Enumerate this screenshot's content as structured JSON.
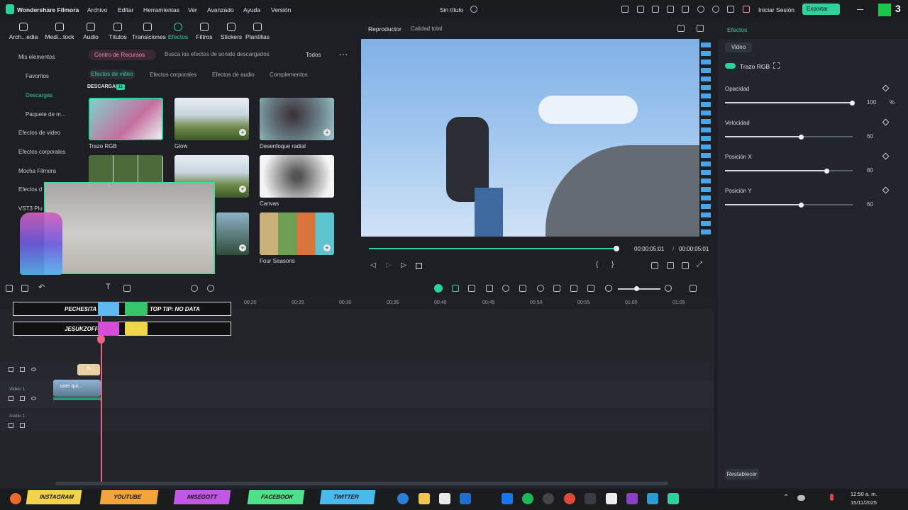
{
  "title_bar": {
    "app_name": "Wondershare Filmora",
    "menu": [
      "Archivo",
      "Editar",
      "Herramientas",
      "Ver",
      "Avanzado",
      "Ayuda",
      "Versión"
    ],
    "doc_title": "Sin título",
    "sign_in": "Iniciar Sesión",
    "export": "Exportar"
  },
  "toolbar": {
    "tools": [
      "Arch...edia",
      "Medi...tock",
      "Audio",
      "Títulos",
      "Transiciones",
      "Efectos",
      "Filtros",
      "Stickers",
      "Plantillas"
    ],
    "active": "Efectos"
  },
  "sidebar": {
    "items": [
      "Mis elementos",
      "Favoritos",
      "Descargas",
      "Paquete de m...",
      "Efectos de video",
      "Efectos corporales",
      "Mocha Filmora",
      "Efectos d",
      "VST3 Plu"
    ]
  },
  "resources": {
    "center_label": "Centro de Recursos",
    "search_placeholder": "Busca los efectos de sonido descargados",
    "filter": "Todos",
    "subtabs": [
      "Efectos de video",
      "Efectos corporales",
      "Efectos de audio",
      "Complementos"
    ],
    "section": "DESCARGAS",
    "section_count": "11",
    "effects": [
      "Trazo RGB",
      "Glow",
      "Desenfoque radial",
      "",
      "",
      "Canvas",
      "",
      "",
      "Four Seasons"
    ]
  },
  "player": {
    "tab": "Reproductor",
    "quality": "Calidad total",
    "current_time": "00:00:05:01",
    "total_time": "00:00:05:01",
    "progress": 0.97
  },
  "properties": {
    "panel_tab": "Efectos",
    "sub_tab": "Video",
    "effect_name": "Trazo RGB",
    "params": [
      {
        "label": "Opacidad",
        "value": "100",
        "unit": "%",
        "fraction": 1.0
      },
      {
        "label": "Velocidad",
        "value": "60",
        "unit": "",
        "fraction": 0.6
      },
      {
        "label": "Posición X",
        "value": "80",
        "unit": "",
        "fraction": 0.8
      },
      {
        "label": "Posición Y",
        "value": "60",
        "unit": "",
        "fraction": 0.6
      }
    ],
    "reset": "Restablecer"
  },
  "timeline": {
    "ruler": [
      "00:20",
      "00:25",
      "00:30",
      "00:35",
      "00:40",
      "00:45",
      "00:50",
      "00:55",
      "01:00",
      "01:05"
    ],
    "tracks": [
      "Video 1",
      "Audio 1"
    ],
    "clip_title": "Tr...",
    "clip_video": "user qui..."
  },
  "overlay": {
    "names": [
      "PECHESITA",
      "JESUKZOFF"
    ],
    "banner": "TOP TIP: NO DATA",
    "socials": [
      "INSTAGRAM",
      "YOUTUBE",
      "MISEGOTT",
      "FACEBOOK",
      "TWITTER"
    ]
  },
  "taskbar": {
    "time": "12:50 a. m.",
    "date": "15/11/2025"
  },
  "colors": {
    "accent": "#2dd19a",
    "pink": "#f08aaa",
    "panel": "#1d1f24"
  }
}
